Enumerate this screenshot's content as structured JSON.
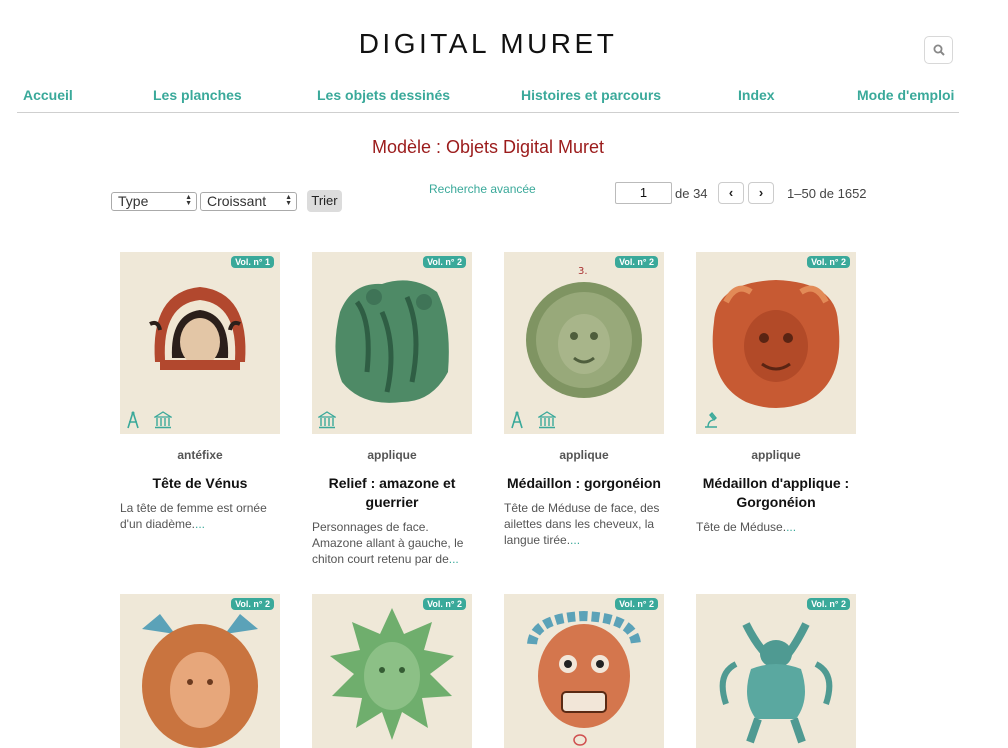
{
  "site": {
    "title": "DIGITAL MURET"
  },
  "nav": {
    "items": [
      {
        "label": "Accueil"
      },
      {
        "label": "Les planches"
      },
      {
        "label": "Les objets dessinés"
      },
      {
        "label": "Histoires et parcours"
      },
      {
        "label": "Index"
      },
      {
        "label": "Mode d'emploi"
      }
    ]
  },
  "page": {
    "heading": "Modèle : Objets Digital Muret"
  },
  "controls": {
    "sort_field": "Type",
    "sort_order": "Croissant",
    "sort_button": "Trier",
    "advanced_search": "Recherche avancée",
    "page_number": "1",
    "page_of": "de 34",
    "prev_arrow": "‹",
    "next_arrow": "›",
    "range": "1–50 de 1652"
  },
  "cards": [
    {
      "volume": "Vol. n° 1",
      "type": "antéfixe",
      "title": "Tête de Vénus",
      "desc": "La tête de femme est ornée d'un diadème.",
      "more": "...",
      "icons": [
        "compass-icon",
        "museum-icon"
      ],
      "color": "#b2482e"
    },
    {
      "volume": "Vol. n° 2",
      "type": "applique",
      "title": "Relief : amazone et guerrier",
      "desc": "Personnages de face. Amazone allant à gauche, le chiton court retenu par de",
      "more": "...",
      "icons": [
        "museum-icon"
      ],
      "color": "#4e8a66"
    },
    {
      "volume": "Vol. n° 2",
      "type": "applique",
      "title": "Médaillon : gorgonéion",
      "desc": "Tête de Méduse de face, des ailettes dans les cheveux, la langue tirée.",
      "more": "...",
      "icons": [
        "compass-icon",
        "museum-icon"
      ],
      "color": "#7f9462"
    },
    {
      "volume": "Vol. n° 2",
      "type": "applique",
      "title": "Médaillon d'applique : Gorgonéion",
      "desc": "Tête de Méduse.",
      "more": "...",
      "icons": [
        "microscope-icon"
      ],
      "color": "#c75a33"
    },
    {
      "volume": "Vol. n° 2",
      "color": "#c9743f"
    },
    {
      "volume": "Vol. n° 2",
      "color": "#6fae6d"
    },
    {
      "volume": "Vol. n° 2",
      "color": "#d4764d"
    },
    {
      "volume": "Vol. n° 2",
      "color": "#4f9a92"
    }
  ]
}
